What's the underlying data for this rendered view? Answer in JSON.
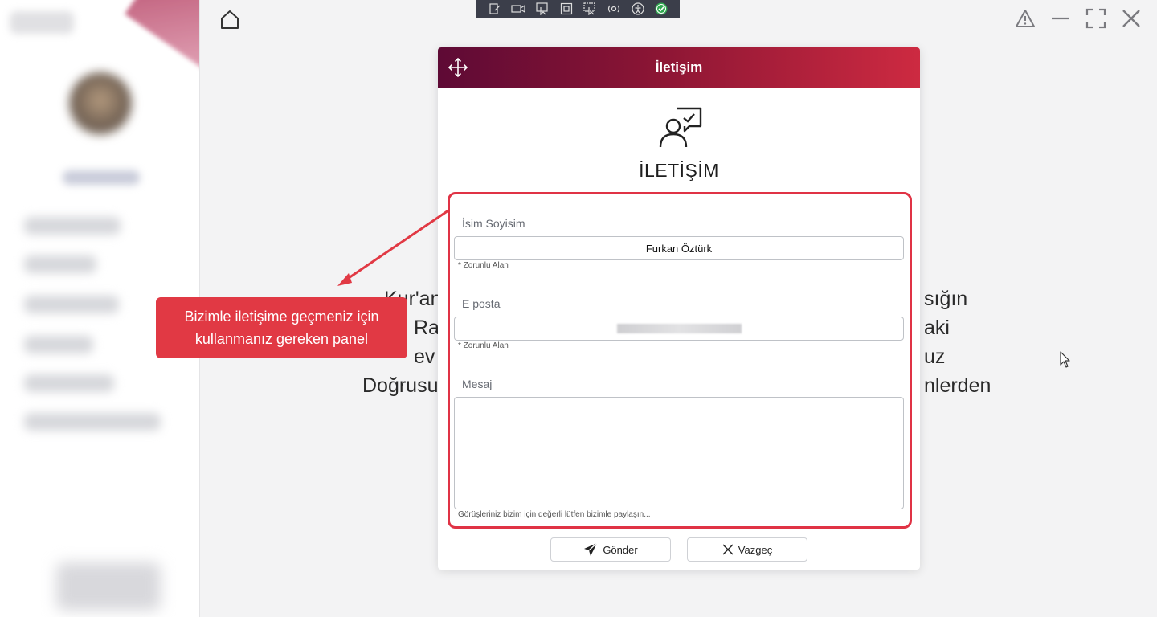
{
  "modal": {
    "title": "İletişim",
    "heading": "İLETİŞİM",
    "fields": {
      "name": {
        "label": "İsim Soyisim",
        "value": "Furkan Öztürk",
        "hint": "* Zorunlu Alan"
      },
      "email": {
        "label": "E posta",
        "value": "",
        "hint": "* Zorunlu Alan"
      },
      "message": {
        "label": "Mesaj",
        "value": "",
        "hint": "Görüşleriniz bizim için değerli lütfen bizimle paylaşın..."
      }
    },
    "buttons": {
      "send": "Gönder",
      "cancel": "Vazgeç"
    }
  },
  "callout": {
    "text": "Bizimle iletişime geçmeniz için kullanmanız gereken panel"
  },
  "background_text": {
    "line1_left": "Kur'an",
    "line1_right": "sığın",
    "line2_left": "Ra",
    "line2_right": "aki",
    "line3_left": "ev",
    "line3_right": "uz",
    "line4_left": "Doğrusu",
    "line4_right": "nlerden"
  },
  "colors": {
    "header_start": "#5e0a35",
    "header_end": "#cd2a41",
    "highlight": "#e03345",
    "callout": "#e13944",
    "toolbar": "#3b3e4a"
  },
  "icons": {
    "home": "home-icon",
    "move": "move-icon",
    "contact": "contact-support-icon",
    "send": "send-icon",
    "cancel": "close-icon",
    "warning": "warning-icon",
    "minimize": "minimize-icon",
    "fullscreen": "fullscreen-icon",
    "close": "close-icon"
  }
}
